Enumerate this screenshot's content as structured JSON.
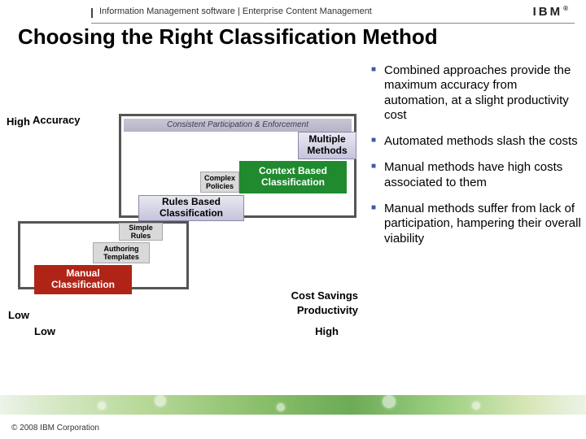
{
  "header": {
    "breadcrumb": "Information Management software | Enterprise Content Management",
    "logo_text": "IBM",
    "logo_reg": "®"
  },
  "title": "Choosing the Right Classification Method",
  "chart": {
    "y_label": "Accuracy",
    "y_high": "High",
    "y_low": "Low",
    "x_low": "Low",
    "x_high": "High",
    "x_label_a": "Cost Savings",
    "x_label_b": "Productivity",
    "frame_top_caption": "Consistent Participation & Enforcement",
    "blocks": {
      "multiple": "Multiple Methods",
      "context": "Context Based Classification",
      "complex": "Complex Policies",
      "rules": "Rules Based Classification",
      "simple": "Simple Rules",
      "authoring": "Authoring Templates",
      "manual": "Manual Classification"
    }
  },
  "bullets": [
    "Combined approaches provide the maximum accuracy from automation, at a slight productivity cost",
    "Automated methods slash the costs",
    "Manual methods have high costs associated to them",
    "Manual methods suffer from lack of participation, hampering their overall viability"
  ],
  "footer": {
    "copyright": "© 2008 IBM Corporation"
  },
  "chart_data": {
    "type": "scatter",
    "title": "Classification method accuracy vs productivity/cost-savings",
    "xlabel": "Cost Savings / Productivity",
    "ylabel": "Accuracy",
    "xlim": [
      0,
      10
    ],
    "ylim": [
      0,
      10
    ],
    "annotations": [
      "Consistent Participation & Enforcement region over automated methods"
    ],
    "series": [
      {
        "name": "Manual Classification",
        "x": 1.5,
        "y": 1.8,
        "group": "manual"
      },
      {
        "name": "Authoring Templates",
        "x": 3.0,
        "y": 3.2,
        "group": "transition"
      },
      {
        "name": "Simple Rules",
        "x": 3.8,
        "y": 4.2,
        "group": "transition"
      },
      {
        "name": "Rules Based Classification",
        "x": 5.0,
        "y": 5.5,
        "group": "automated"
      },
      {
        "name": "Complex Policies",
        "x": 5.8,
        "y": 6.5,
        "group": "transition"
      },
      {
        "name": "Context Based Classification",
        "x": 7.5,
        "y": 7.0,
        "group": "automated"
      },
      {
        "name": "Multiple Methods",
        "x": 8.8,
        "y": 8.5,
        "group": "automated"
      }
    ]
  }
}
